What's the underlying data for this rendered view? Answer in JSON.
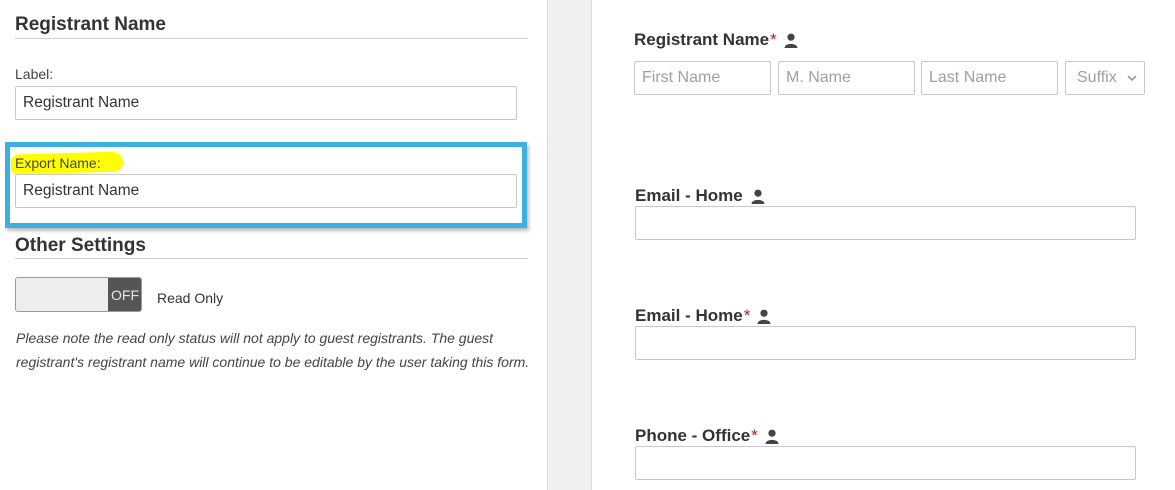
{
  "settings": {
    "title": "Registrant Name",
    "label": {
      "caption": "Label:",
      "value": "Registrant Name"
    },
    "export_name": {
      "caption": "Export Name:",
      "value": "Registrant Name"
    },
    "other_title": "Other Settings",
    "read_only": {
      "state": "OFF",
      "label": "Read Only"
    },
    "note": "Please note the read only status will not apply to guest registrants. The guest registrant's registrant name will continue to be editable by the user taking this form."
  },
  "preview": {
    "registrant_name": {
      "label": "Registrant Name",
      "required": "*",
      "first_placeholder": "First Name",
      "middle_placeholder": "M. Name",
      "last_placeholder": "Last Name",
      "suffix_placeholder": "Suffix"
    },
    "email_home_1": {
      "label": "Email - Home",
      "required": ""
    },
    "email_home_2": {
      "label": "Email - Home",
      "required": "*"
    },
    "phone_office": {
      "label": "Phone - Office",
      "required": "*"
    }
  },
  "colors": {
    "highlight_border": "#3db0e0",
    "marker": "#ffff00",
    "required": "#b22222"
  },
  "icons": [
    "person-icon",
    "chevron-down-icon"
  ]
}
